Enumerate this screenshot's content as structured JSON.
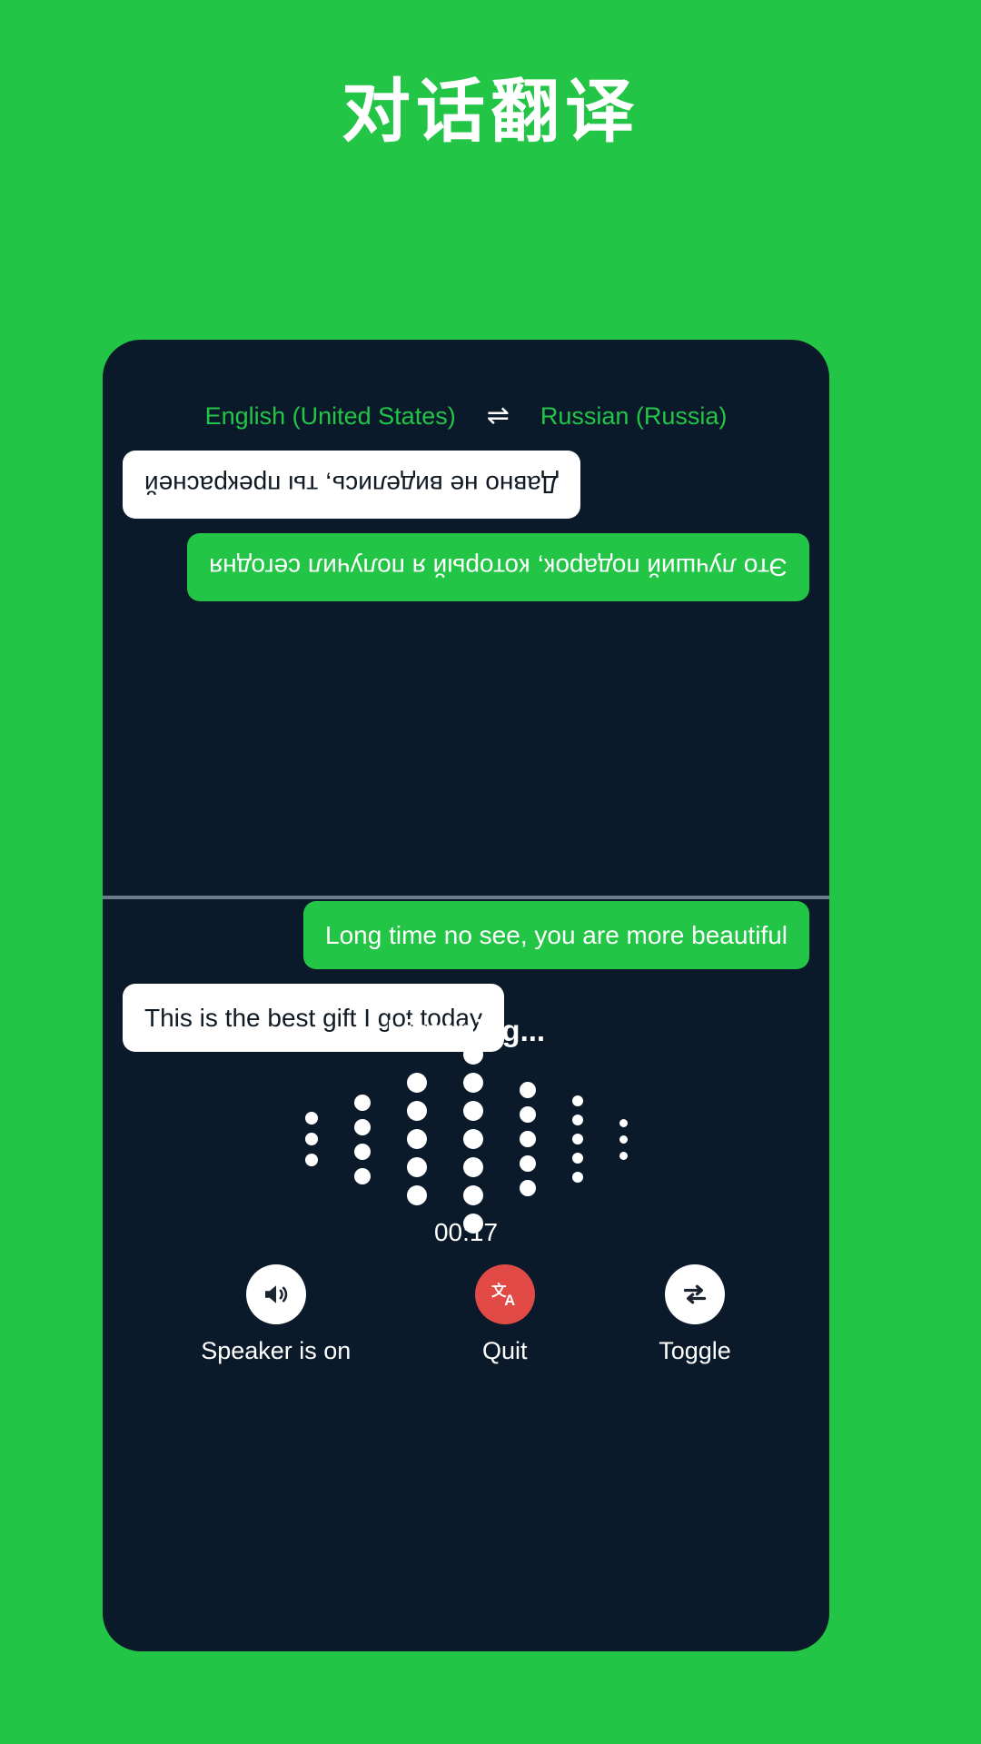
{
  "page": {
    "title": "对话翻译",
    "background_color": "#22c546"
  },
  "panel": {
    "background_color": "#0b1a2a",
    "accent_color": "#22c546"
  },
  "language_bar": {
    "source_language": "English (United States)",
    "target_language": "Russian (Russia)",
    "swap_icon": "⇌",
    "swap_icon_name": "swap-languages-icon"
  },
  "conversation": {
    "remote": {
      "rotated": true,
      "messages": [
        {
          "text": "Это лучший подарок, который я получил сегодня",
          "style": "green"
        },
        {
          "text": "Давно не виделись, ты прекрасней",
          "style": "white"
        }
      ]
    },
    "local": {
      "rotated": false,
      "messages": [
        {
          "text": "Long time no see, you are more beautiful",
          "style": "green"
        },
        {
          "text": "This is the best gift I got today",
          "style": "white"
        }
      ]
    }
  },
  "status": {
    "listening_label": "Listening...",
    "timer": "00:17"
  },
  "waveform": {
    "columns": [
      {
        "count": 3,
        "size": 14
      },
      {
        "count": 4,
        "size": 18
      },
      {
        "count": 5,
        "size": 22
      },
      {
        "count": 7,
        "size": 22
      },
      {
        "count": 5,
        "size": 18
      },
      {
        "count": 5,
        "size": 12
      },
      {
        "count": 3,
        "size": 9
      }
    ],
    "dot_color": "#ffffff"
  },
  "controls": [
    {
      "label": "Speaker is on",
      "icon": "speaker-on-icon",
      "circle_color": "#ffffff",
      "icon_color": "#1c2430"
    },
    {
      "label": "Quit",
      "icon": "translate-icon",
      "circle_color": "#e24a45",
      "icon_color": "#ffffff"
    },
    {
      "label": "Toggle",
      "icon": "toggle-repeat-icon",
      "circle_color": "#ffffff",
      "icon_color": "#1c2430"
    }
  ]
}
